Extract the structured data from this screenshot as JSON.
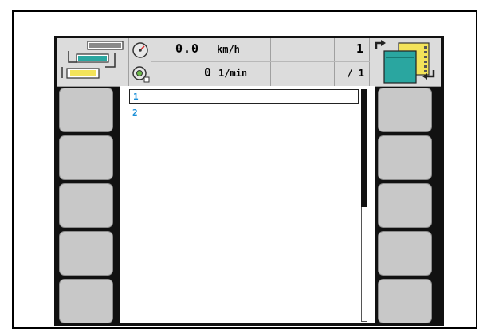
{
  "header": {
    "speed_value": "0.0",
    "speed_unit": "km/h",
    "rpm_value": "0",
    "rpm_unit": "1/min",
    "page_current": "1",
    "page_total": "/ 1"
  },
  "list": {
    "items": [
      {
        "label": "1",
        "selected": true
      },
      {
        "label": "2",
        "selected": false
      }
    ]
  },
  "colors": {
    "item_text": "#1a8fd8",
    "softkey_fill": "#c8c8c8",
    "header_bg": "#dcdcdc"
  },
  "icons": {
    "header_left": "implement-configuration-icon",
    "speed_sensor": "speedometer-icon",
    "pto_sensor": "pto-rpm-icon",
    "header_right": "workset-switch-icon"
  },
  "softkeys": {
    "left_count": 5,
    "right_count": 5
  }
}
